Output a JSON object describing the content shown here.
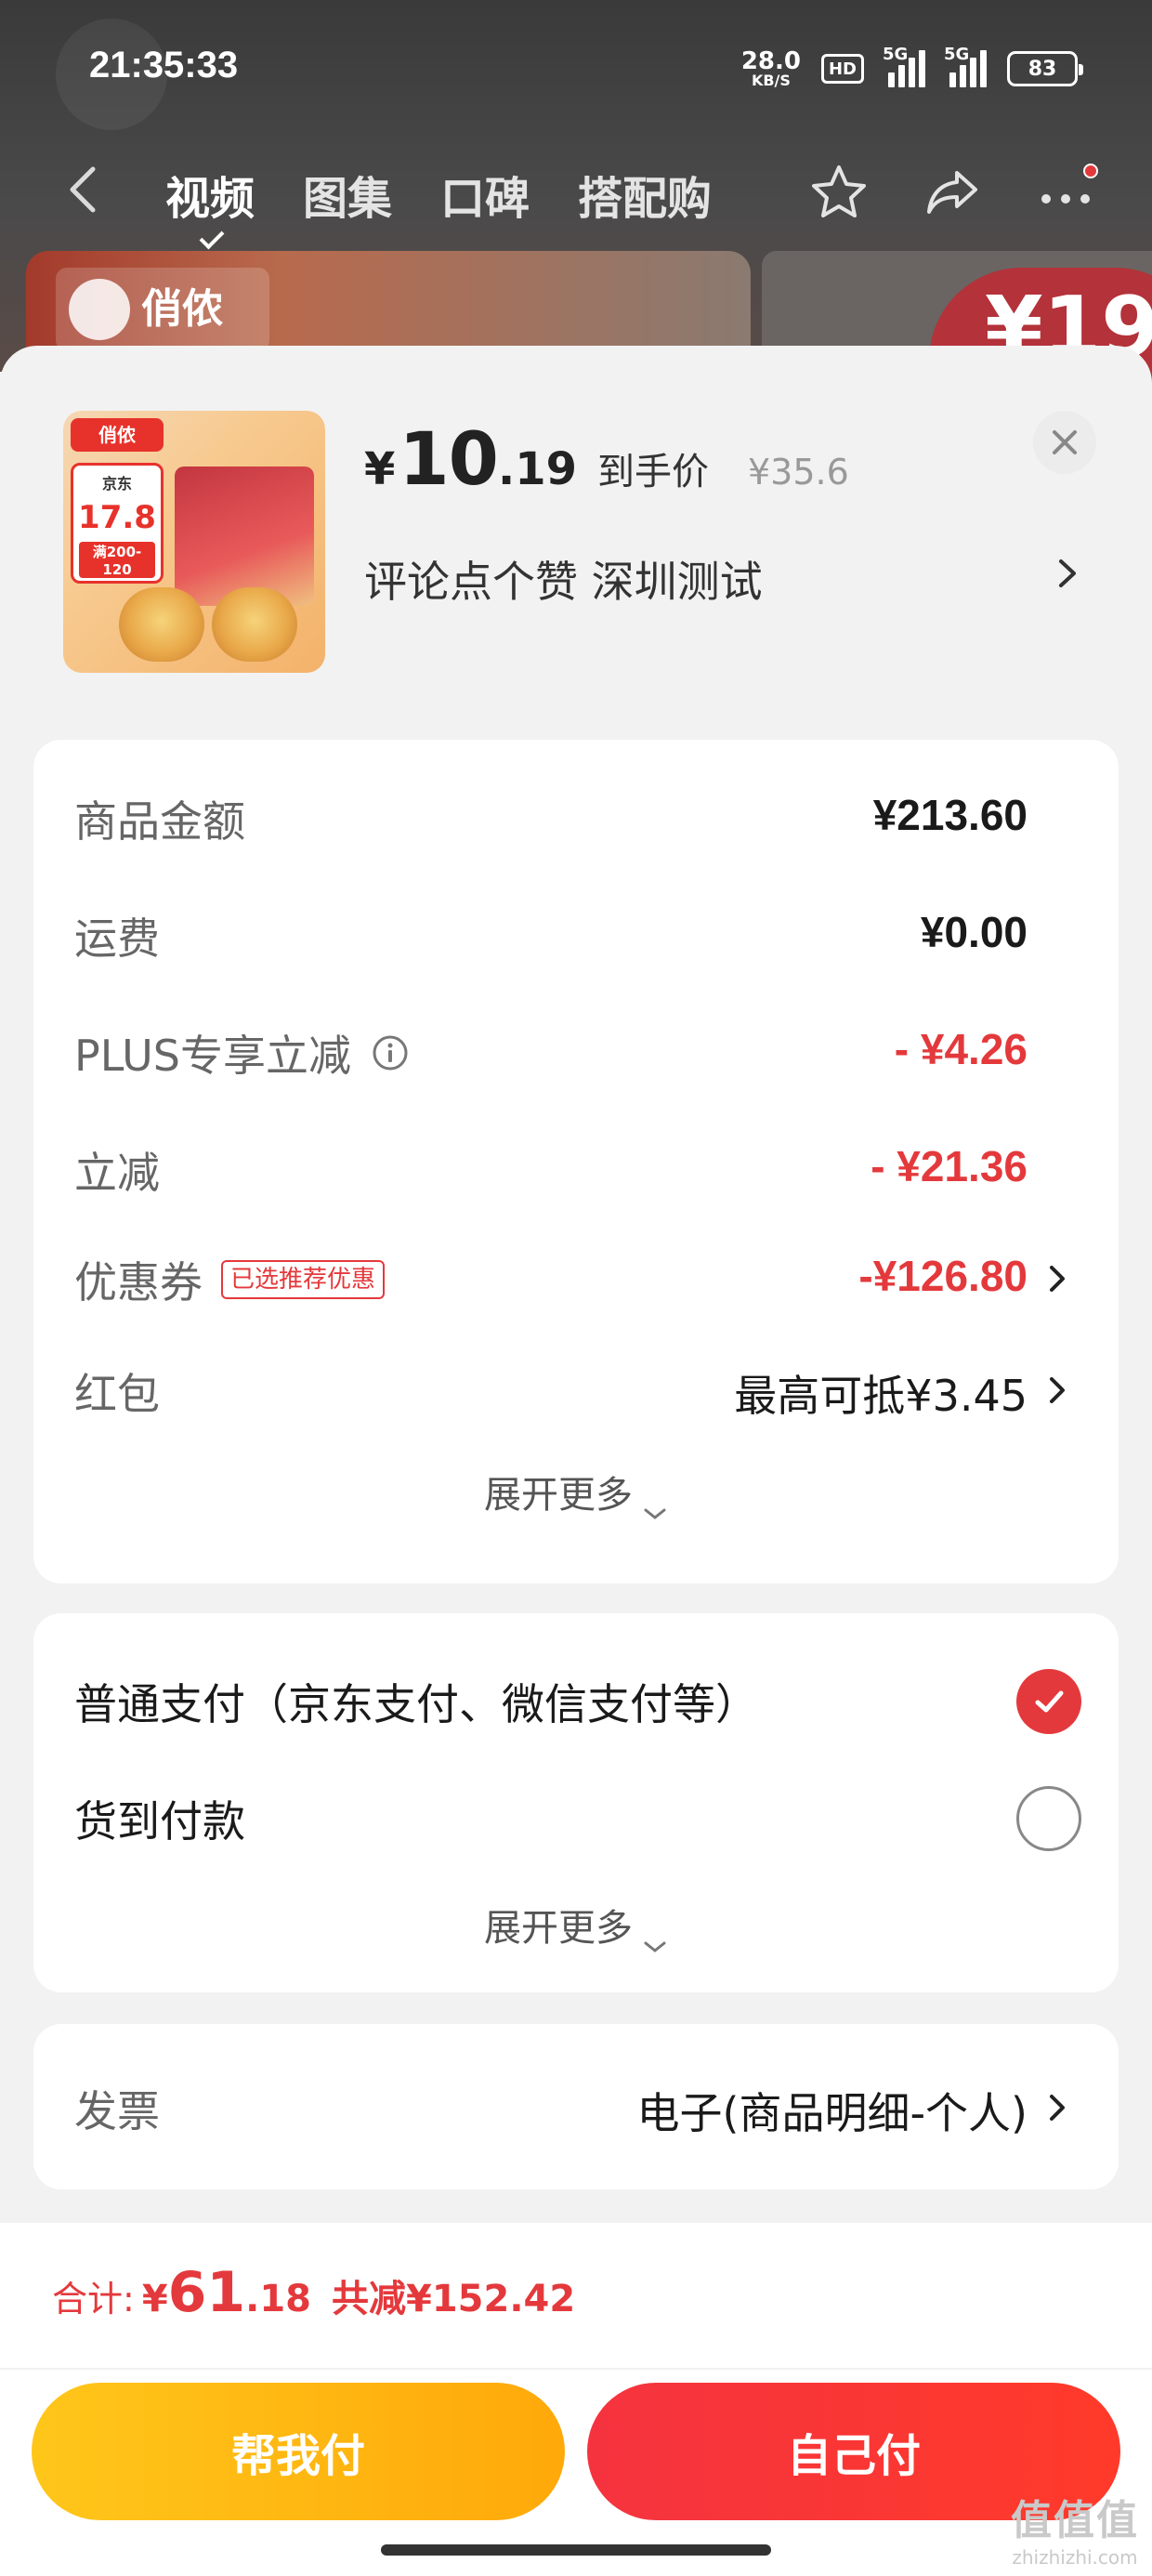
{
  "status_bar": {
    "time": "21:35:33",
    "net_speed_value": "28.0",
    "net_speed_unit": "KB/S",
    "hd_label": "HD",
    "signal_1": "5G",
    "signal_2": "5G",
    "battery": "83"
  },
  "top_nav": {
    "tabs": [
      "视频",
      "图集",
      "口碑",
      "搭配购"
    ],
    "active_tab": 0
  },
  "background": {
    "banner_brand": "俏侬",
    "price_hint": "¥19"
  },
  "product": {
    "thumb_brand": "俏侬",
    "thumb_store": "京东",
    "thumb_price": "17.8",
    "thumb_promo": "满200-120",
    "price_yen": "¥",
    "price_int": "10",
    "price_dec": ".19",
    "price_label": "到手价",
    "original_price": "¥35.6",
    "subtitle": "评论点个赞  深圳测试"
  },
  "amounts": {
    "rows": [
      {
        "label": "商品金额",
        "value": "¥213.60",
        "color": "normal"
      },
      {
        "label": "运费",
        "value": "¥0.00",
        "color": "normal"
      },
      {
        "label": "PLUS专享立减",
        "value": "- ¥4.26",
        "color": "red",
        "info": true
      },
      {
        "label": "立减",
        "value": "- ¥21.36",
        "color": "red"
      },
      {
        "label": "优惠券",
        "tag": "已选推荐优惠",
        "value": "-¥126.80",
        "color": "red",
        "arrow": true
      },
      {
        "label": "红包",
        "value": "最高可抵¥3.45",
        "color": "normal",
        "arrow": true
      }
    ],
    "expand_label": "展开更多"
  },
  "payment": {
    "options": [
      {
        "label": "普通支付（京东支付、微信支付等）",
        "selected": true
      },
      {
        "label": "货到付款",
        "selected": false
      }
    ],
    "expand_label": "展开更多"
  },
  "invoice": {
    "label": "发票",
    "value": "电子(商品明细-个人)"
  },
  "footer": {
    "total_label": "合计:",
    "total_yen": "¥",
    "total_int": "61",
    "total_dec": ".18",
    "total_saved": "共减¥152.42",
    "help_pay_button": "帮我付",
    "self_pay_button": "自己付"
  },
  "watermark": {
    "line1": "值值值",
    "line2": "zhizhizhi.com"
  },
  "colors": {
    "accent_red": "#e4393c",
    "button_yellow": "#ffb80f",
    "button_red": "#f5333f"
  }
}
